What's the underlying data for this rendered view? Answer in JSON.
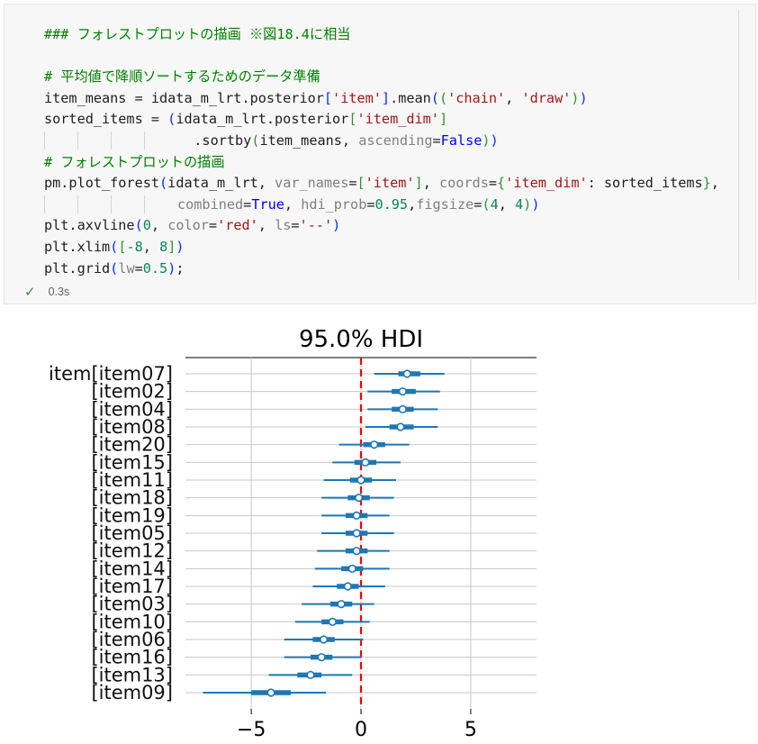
{
  "notebook_cell": {
    "code_lines": [
      [
        {
          "t": "### フォレストプロットの描画 ※図18.4に相当",
          "c": "c-comment"
        }
      ],
      [],
      [
        {
          "t": "# 平均値で降順ソートするためのデータ準備",
          "c": "c-comment"
        }
      ],
      [
        {
          "t": "item_means = idata_m_lrt.posterior"
        },
        {
          "t": "[",
          "c": "c-p1"
        },
        {
          "t": "'item'",
          "c": "c-str"
        },
        {
          "t": "]",
          "c": "c-p1"
        },
        {
          "t": ".mean"
        },
        {
          "t": "(",
          "c": "c-p1"
        },
        {
          "t": "(",
          "c": "c-p2"
        },
        {
          "t": "'chain'",
          "c": "c-str"
        },
        {
          "t": ", "
        },
        {
          "t": "'draw'",
          "c": "c-str"
        },
        {
          "t": ")",
          "c": "c-p2"
        },
        {
          "t": ")",
          "c": "c-p1"
        }
      ],
      [
        {
          "t": "sorted_items = "
        },
        {
          "t": "(",
          "c": "c-p1"
        },
        {
          "t": "idata_m_lrt.posterior"
        },
        {
          "t": "[",
          "c": "c-p2"
        },
        {
          "t": "'item_dim'",
          "c": "c-str"
        },
        {
          "t": "]",
          "c": "c-p2"
        }
      ],
      [
        {
          "guides": 4
        },
        {
          "t": "  .sortby"
        },
        {
          "t": "(",
          "c": "c-p2"
        },
        {
          "t": "item_means, "
        },
        {
          "t": "ascending",
          "c": "c-param"
        },
        {
          "t": "="
        },
        {
          "t": "False",
          "c": "c-kw"
        },
        {
          "t": ")",
          "c": "c-p2"
        },
        {
          "t": ")",
          "c": "c-p1"
        }
      ],
      [
        {
          "t": "# フォレストプロットの描画",
          "c": "c-comment"
        }
      ],
      [
        {
          "t": "pm.plot_forest"
        },
        {
          "t": "(",
          "c": "c-p1"
        },
        {
          "t": "idata_m_lrt, "
        },
        {
          "t": "var_names",
          "c": "c-param"
        },
        {
          "t": "="
        },
        {
          "t": "[",
          "c": "c-p2"
        },
        {
          "t": "'item'",
          "c": "c-str"
        },
        {
          "t": "]",
          "c": "c-p2"
        },
        {
          "t": ", "
        },
        {
          "t": "coords",
          "c": "c-param"
        },
        {
          "t": "="
        },
        {
          "t": "{",
          "c": "c-p2"
        },
        {
          "t": "'item_dim'",
          "c": "c-str"
        },
        {
          "t": ": sorted_items"
        },
        {
          "t": "}",
          "c": "c-p2"
        },
        {
          "t": ","
        }
      ],
      [
        {
          "guides": 4
        },
        {
          "t": "combined",
          "c": "c-param"
        },
        {
          "t": "="
        },
        {
          "t": "True",
          "c": "c-kw"
        },
        {
          "t": ", "
        },
        {
          "t": "hdi_prob",
          "c": "c-param"
        },
        {
          "t": "="
        },
        {
          "t": "0.95",
          "c": "c-num"
        },
        {
          "t": ","
        },
        {
          "t": "figsize",
          "c": "c-param"
        },
        {
          "t": "="
        },
        {
          "t": "(",
          "c": "c-p2"
        },
        {
          "t": "4",
          "c": "c-num"
        },
        {
          "t": ", "
        },
        {
          "t": "4",
          "c": "c-num"
        },
        {
          "t": ")",
          "c": "c-p2"
        },
        {
          "t": ")",
          "c": "c-p1"
        }
      ],
      [
        {
          "t": "plt.axvline"
        },
        {
          "t": "(",
          "c": "c-p1"
        },
        {
          "t": "0",
          "c": "c-num"
        },
        {
          "t": ", "
        },
        {
          "t": "color",
          "c": "c-param"
        },
        {
          "t": "="
        },
        {
          "t": "'red'",
          "c": "c-str"
        },
        {
          "t": ", "
        },
        {
          "t": "ls",
          "c": "c-param"
        },
        {
          "t": "="
        },
        {
          "t": "'--'",
          "c": "c-str"
        },
        {
          "t": ")",
          "c": "c-p1"
        }
      ],
      [
        {
          "t": "plt.xlim"
        },
        {
          "t": "(",
          "c": "c-p1"
        },
        {
          "t": "[",
          "c": "c-p2"
        },
        {
          "t": "-8",
          "c": "c-num"
        },
        {
          "t": ", "
        },
        {
          "t": "8",
          "c": "c-num"
        },
        {
          "t": "]",
          "c": "c-p2"
        },
        {
          "t": ")",
          "c": "c-p1"
        }
      ],
      [
        {
          "t": "plt.grid"
        },
        {
          "t": "(",
          "c": "c-p1"
        },
        {
          "t": "lw",
          "c": "c-param"
        },
        {
          "t": "="
        },
        {
          "t": "0.5",
          "c": "c-num"
        },
        {
          "t": ")",
          "c": "c-p1"
        },
        {
          "t": ";"
        }
      ]
    ],
    "status": {
      "icon": "check-icon",
      "check_glyph": "✓",
      "time": "0.3s",
      "check_color": "#388a34"
    }
  },
  "chart_data": {
    "type": "forest",
    "title": "95.0% HDI",
    "xlim": [
      -8,
      8
    ],
    "xticks": [
      -5,
      0,
      5
    ],
    "xtick_labels": [
      "−5",
      "0",
      "5"
    ],
    "grid": true,
    "refline": {
      "x": 0,
      "color": "#ff0000",
      "style": "dashed"
    },
    "series_color": "#1f77b4",
    "first_label": "item[item07]",
    "items": [
      {
        "label": "item07",
        "mean": 2.1,
        "hdi": [
          0.6,
          3.8
        ],
        "iqr": [
          1.7,
          2.7
        ]
      },
      {
        "label": "item02",
        "mean": 1.9,
        "hdi": [
          0.3,
          3.6
        ],
        "iqr": [
          1.4,
          2.5
        ]
      },
      {
        "label": "item04",
        "mean": 1.9,
        "hdi": [
          0.3,
          3.5
        ],
        "iqr": [
          1.4,
          2.4
        ]
      },
      {
        "label": "item08",
        "mean": 1.8,
        "hdi": [
          0.2,
          3.5
        ],
        "iqr": [
          1.3,
          2.4
        ]
      },
      {
        "label": "item20",
        "mean": 0.6,
        "hdi": [
          -1.0,
          2.2
        ],
        "iqr": [
          0.1,
          1.1
        ]
      },
      {
        "label": "item15",
        "mean": 0.2,
        "hdi": [
          -1.3,
          1.8
        ],
        "iqr": [
          -0.3,
          0.7
        ]
      },
      {
        "label": "item11",
        "mean": 0.0,
        "hdi": [
          -1.7,
          1.6
        ],
        "iqr": [
          -0.5,
          0.5
        ]
      },
      {
        "label": "item18",
        "mean": -0.1,
        "hdi": [
          -1.8,
          1.5
        ],
        "iqr": [
          -0.6,
          0.4
        ]
      },
      {
        "label": "item19",
        "mean": -0.2,
        "hdi": [
          -1.8,
          1.3
        ],
        "iqr": [
          -0.7,
          0.3
        ]
      },
      {
        "label": "item05",
        "mean": -0.2,
        "hdi": [
          -1.8,
          1.5
        ],
        "iqr": [
          -0.7,
          0.3
        ]
      },
      {
        "label": "item12",
        "mean": -0.2,
        "hdi": [
          -2.0,
          1.3
        ],
        "iqr": [
          -0.7,
          0.3
        ]
      },
      {
        "label": "item14",
        "mean": -0.4,
        "hdi": [
          -2.1,
          1.3
        ],
        "iqr": [
          -0.9,
          0.1
        ]
      },
      {
        "label": "item17",
        "mean": -0.6,
        "hdi": [
          -2.2,
          1.1
        ],
        "iqr": [
          -1.1,
          -0.1
        ]
      },
      {
        "label": "item03",
        "mean": -0.9,
        "hdi": [
          -2.7,
          0.6
        ],
        "iqr": [
          -1.4,
          -0.4
        ]
      },
      {
        "label": "item10",
        "mean": -1.3,
        "hdi": [
          -3.0,
          0.4
        ],
        "iqr": [
          -1.8,
          -0.8
        ]
      },
      {
        "label": "item06",
        "mean": -1.7,
        "hdi": [
          -3.5,
          0.1
        ],
        "iqr": [
          -2.2,
          -1.2
        ]
      },
      {
        "label": "item16",
        "mean": -1.8,
        "hdi": [
          -3.5,
          0.0
        ],
        "iqr": [
          -2.3,
          -1.3
        ]
      },
      {
        "label": "item13",
        "mean": -2.3,
        "hdi": [
          -4.2,
          -0.4
        ],
        "iqr": [
          -2.9,
          -1.8
        ]
      },
      {
        "label": "item09",
        "mean": -4.1,
        "hdi": [
          -7.2,
          -1.6
        ],
        "iqr": [
          -5.0,
          -3.2
        ]
      }
    ]
  }
}
